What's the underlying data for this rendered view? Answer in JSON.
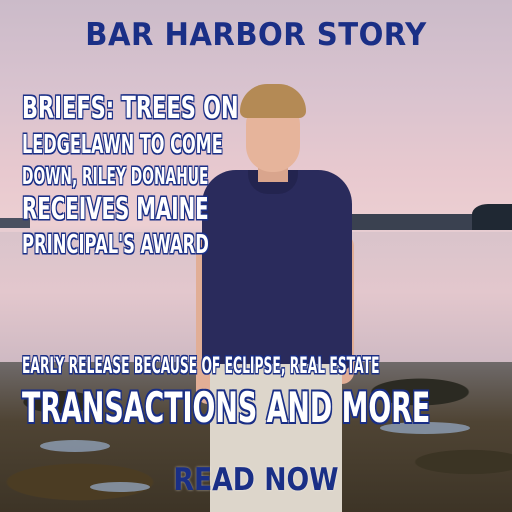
{
  "brand": {
    "title": "BAR HARBOR STORY"
  },
  "headline": {
    "lines": [
      "BRIEFS: TREES ON",
      "LEDGELAWN TO COME",
      "DOWN, RILEY DONAHUE",
      "RECEIVES MAINE",
      "PRINCIPAL'S AWARD"
    ]
  },
  "subhead": {
    "line1": "EARLY RELEASE BECAUSE OF ECLIPSE, REAL ESTATE",
    "line2": "TRANSACTIONS AND MORE"
  },
  "cta": {
    "label": "READ NOW"
  },
  "colors": {
    "brand_blue": "#1a2f86",
    "text_white": "#ffffff"
  }
}
